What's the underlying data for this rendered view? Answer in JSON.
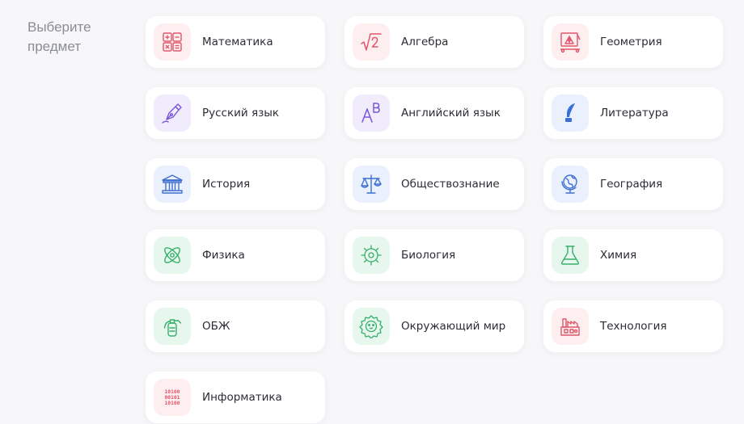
{
  "side": {
    "label_line1": "Выберите",
    "label_line2": "предмет"
  },
  "colors": {
    "red": "#e0566b",
    "purple": "#7a55d6",
    "blue": "#4070d0",
    "green": "#36b06a"
  },
  "subjects": [
    {
      "label": "Математика",
      "icon": "math-grid-icon"
    },
    {
      "label": "Алгебра",
      "icon": "square-root-icon"
    },
    {
      "label": "Геометрия",
      "icon": "drafting-board-icon"
    },
    {
      "label": "Русский язык",
      "icon": "fountain-pen-icon"
    },
    {
      "label": "Английский язык",
      "icon": "letters-ab-icon"
    },
    {
      "label": "Литература",
      "icon": "quill-icon"
    },
    {
      "label": "История",
      "icon": "museum-icon"
    },
    {
      "label": "Обществознание",
      "icon": "scales-icon"
    },
    {
      "label": "География",
      "icon": "globe-icon"
    },
    {
      "label": "Физика",
      "icon": "atom-icon"
    },
    {
      "label": "Биология",
      "icon": "cell-icon"
    },
    {
      "label": "Химия",
      "icon": "flask-icon"
    },
    {
      "label": "ОБЖ",
      "icon": "fire-extinguisher-icon"
    },
    {
      "label": "Окружающий мир",
      "icon": "lion-icon"
    },
    {
      "label": "Технология",
      "icon": "factory-icon"
    },
    {
      "label": "Информатика",
      "icon": "binary-icon"
    }
  ],
  "binary_text": {
    "line1": "10100",
    "line2": "00101",
    "line3": "10100"
  }
}
